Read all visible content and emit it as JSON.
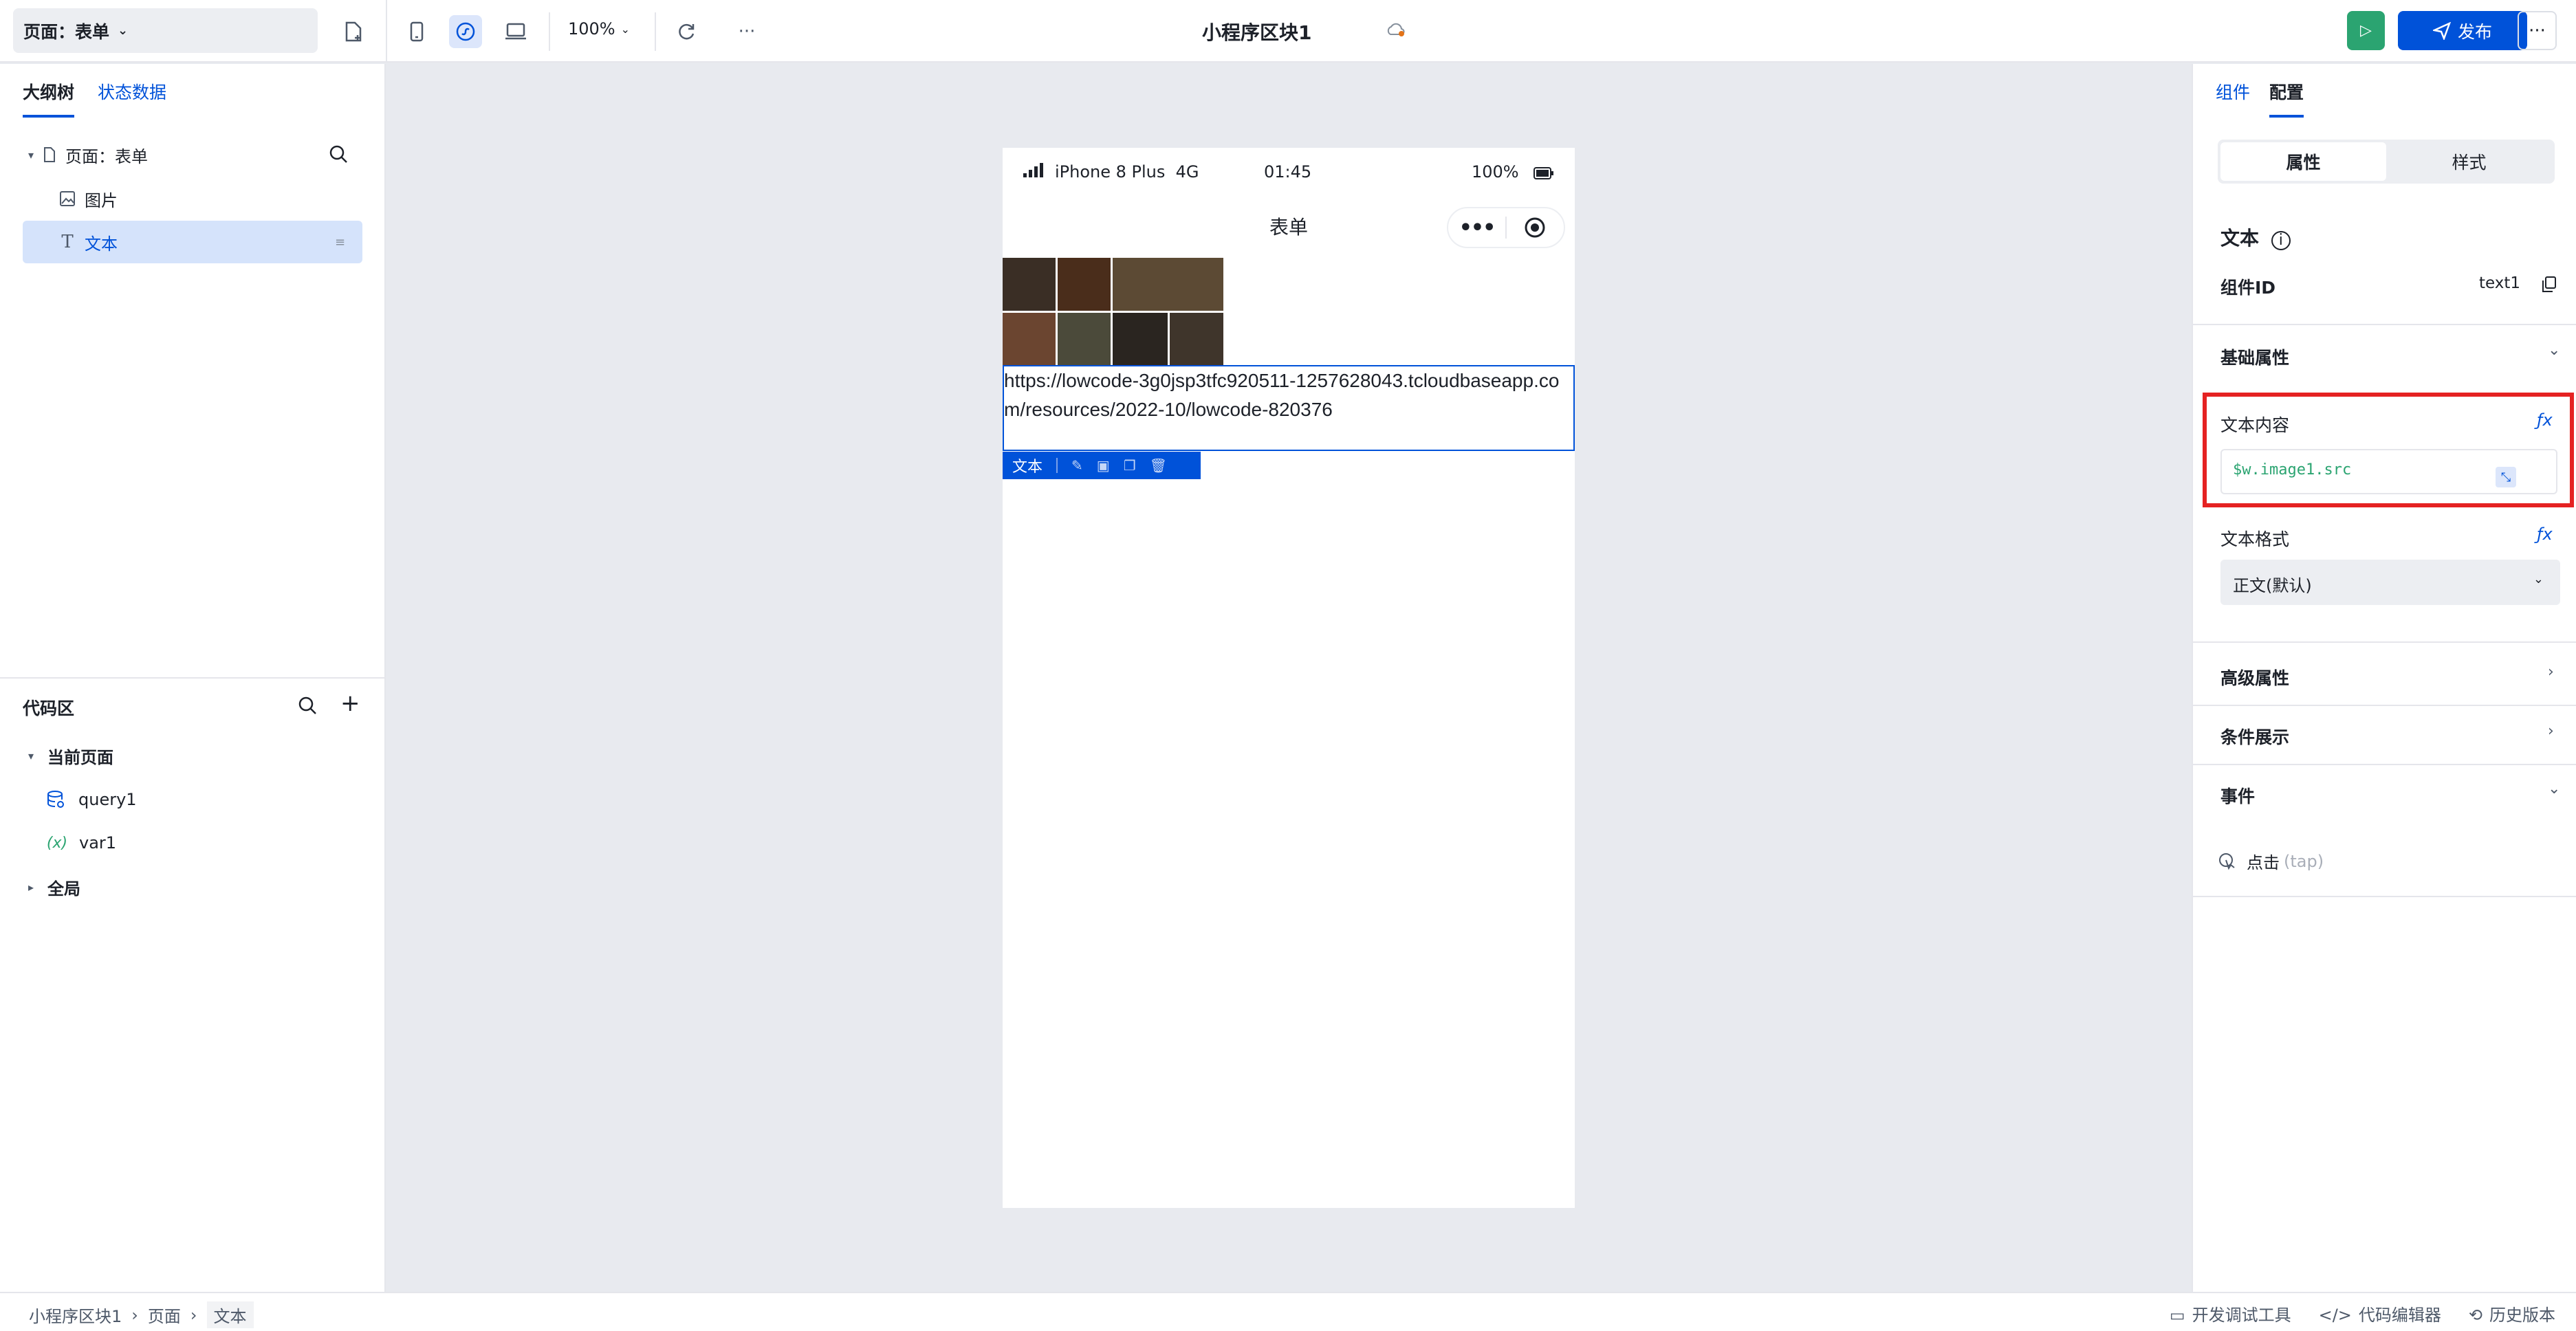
{
  "topbar": {
    "page_select": "页面：表单",
    "zoom": "100%",
    "app_title": "小程序区块1",
    "publish_label": "发布",
    "more_label": "···",
    "toolbar_more": "···"
  },
  "left": {
    "tabs": [
      "大纲树",
      "状态数据"
    ],
    "outline": [
      {
        "label": "页面：表单"
      },
      {
        "label": "图片"
      },
      {
        "label": "文本"
      }
    ],
    "code_title": "代码区",
    "current_page": "当前页面",
    "query": "query1",
    "var_icon": "(x)",
    "var": "var1",
    "global": "全局"
  },
  "phone": {
    "signal": "iPhone 8 Plus  4G",
    "time": "01:45",
    "battery": "100%",
    "nav_title": "表单",
    "text_content": "https://lowcode-3g0jsp3tfc920511-1257628043.tcloudbaseapp.com/resources/2022-10/lowcode-820376",
    "toolbar_label": "文本"
  },
  "right": {
    "tabs": [
      "组件",
      "配置"
    ],
    "seg": [
      "属性",
      "样式"
    ],
    "component_name": "文本",
    "id_label": "组件ID",
    "id_value": "text1",
    "basic_props": "基础属性",
    "content_label": "文本内容",
    "content_value": "$w.image1.src",
    "format_label": "文本格式",
    "format_value": "正文(默认)",
    "advanced": "高级属性",
    "conditional": "条件展示",
    "events": "事件",
    "event_tap": "点击",
    "event_tap_hint": "(tap)"
  },
  "bottom": {
    "crumbs": [
      "小程序区块1",
      "页面",
      "文本"
    ],
    "tools": [
      "开发调试工具",
      "代码编辑器",
      "历史版本"
    ]
  },
  "colors": {
    "accent": "#0052d9",
    "run": "#2ba471",
    "highlight": "#e52222"
  }
}
